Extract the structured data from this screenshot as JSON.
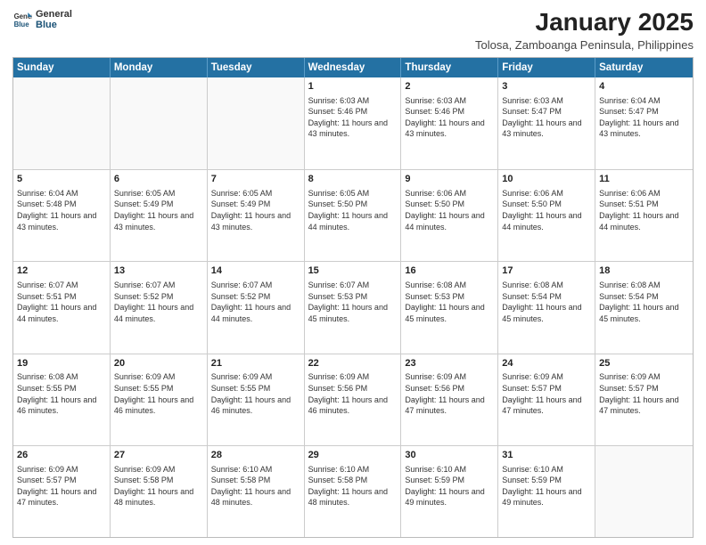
{
  "header": {
    "logo_general": "General",
    "logo_blue": "Blue",
    "month_title": "January 2025",
    "location": "Tolosa, Zamboanga Peninsula, Philippines"
  },
  "days_of_week": [
    "Sunday",
    "Monday",
    "Tuesday",
    "Wednesday",
    "Thursday",
    "Friday",
    "Saturday"
  ],
  "weeks": [
    [
      {
        "day": "",
        "sunrise": "",
        "sunset": "",
        "daylight": "",
        "empty": true
      },
      {
        "day": "",
        "sunrise": "",
        "sunset": "",
        "daylight": "",
        "empty": true
      },
      {
        "day": "",
        "sunrise": "",
        "sunset": "",
        "daylight": "",
        "empty": true
      },
      {
        "day": "1",
        "sunrise": "Sunrise: 6:03 AM",
        "sunset": "Sunset: 5:46 PM",
        "daylight": "Daylight: 11 hours and 43 minutes."
      },
      {
        "day": "2",
        "sunrise": "Sunrise: 6:03 AM",
        "sunset": "Sunset: 5:46 PM",
        "daylight": "Daylight: 11 hours and 43 minutes."
      },
      {
        "day": "3",
        "sunrise": "Sunrise: 6:03 AM",
        "sunset": "Sunset: 5:47 PM",
        "daylight": "Daylight: 11 hours and 43 minutes."
      },
      {
        "day": "4",
        "sunrise": "Sunrise: 6:04 AM",
        "sunset": "Sunset: 5:47 PM",
        "daylight": "Daylight: 11 hours and 43 minutes."
      }
    ],
    [
      {
        "day": "5",
        "sunrise": "Sunrise: 6:04 AM",
        "sunset": "Sunset: 5:48 PM",
        "daylight": "Daylight: 11 hours and 43 minutes."
      },
      {
        "day": "6",
        "sunrise": "Sunrise: 6:05 AM",
        "sunset": "Sunset: 5:49 PM",
        "daylight": "Daylight: 11 hours and 43 minutes."
      },
      {
        "day": "7",
        "sunrise": "Sunrise: 6:05 AM",
        "sunset": "Sunset: 5:49 PM",
        "daylight": "Daylight: 11 hours and 43 minutes."
      },
      {
        "day": "8",
        "sunrise": "Sunrise: 6:05 AM",
        "sunset": "Sunset: 5:50 PM",
        "daylight": "Daylight: 11 hours and 44 minutes."
      },
      {
        "day": "9",
        "sunrise": "Sunrise: 6:06 AM",
        "sunset": "Sunset: 5:50 PM",
        "daylight": "Daylight: 11 hours and 44 minutes."
      },
      {
        "day": "10",
        "sunrise": "Sunrise: 6:06 AM",
        "sunset": "Sunset: 5:50 PM",
        "daylight": "Daylight: 11 hours and 44 minutes."
      },
      {
        "day": "11",
        "sunrise": "Sunrise: 6:06 AM",
        "sunset": "Sunset: 5:51 PM",
        "daylight": "Daylight: 11 hours and 44 minutes."
      }
    ],
    [
      {
        "day": "12",
        "sunrise": "Sunrise: 6:07 AM",
        "sunset": "Sunset: 5:51 PM",
        "daylight": "Daylight: 11 hours and 44 minutes."
      },
      {
        "day": "13",
        "sunrise": "Sunrise: 6:07 AM",
        "sunset": "Sunset: 5:52 PM",
        "daylight": "Daylight: 11 hours and 44 minutes."
      },
      {
        "day": "14",
        "sunrise": "Sunrise: 6:07 AM",
        "sunset": "Sunset: 5:52 PM",
        "daylight": "Daylight: 11 hours and 44 minutes."
      },
      {
        "day": "15",
        "sunrise": "Sunrise: 6:07 AM",
        "sunset": "Sunset: 5:53 PM",
        "daylight": "Daylight: 11 hours and 45 minutes."
      },
      {
        "day": "16",
        "sunrise": "Sunrise: 6:08 AM",
        "sunset": "Sunset: 5:53 PM",
        "daylight": "Daylight: 11 hours and 45 minutes."
      },
      {
        "day": "17",
        "sunrise": "Sunrise: 6:08 AM",
        "sunset": "Sunset: 5:54 PM",
        "daylight": "Daylight: 11 hours and 45 minutes."
      },
      {
        "day": "18",
        "sunrise": "Sunrise: 6:08 AM",
        "sunset": "Sunset: 5:54 PM",
        "daylight": "Daylight: 11 hours and 45 minutes."
      }
    ],
    [
      {
        "day": "19",
        "sunrise": "Sunrise: 6:08 AM",
        "sunset": "Sunset: 5:55 PM",
        "daylight": "Daylight: 11 hours and 46 minutes."
      },
      {
        "day": "20",
        "sunrise": "Sunrise: 6:09 AM",
        "sunset": "Sunset: 5:55 PM",
        "daylight": "Daylight: 11 hours and 46 minutes."
      },
      {
        "day": "21",
        "sunrise": "Sunrise: 6:09 AM",
        "sunset": "Sunset: 5:55 PM",
        "daylight": "Daylight: 11 hours and 46 minutes."
      },
      {
        "day": "22",
        "sunrise": "Sunrise: 6:09 AM",
        "sunset": "Sunset: 5:56 PM",
        "daylight": "Daylight: 11 hours and 46 minutes."
      },
      {
        "day": "23",
        "sunrise": "Sunrise: 6:09 AM",
        "sunset": "Sunset: 5:56 PM",
        "daylight": "Daylight: 11 hours and 47 minutes."
      },
      {
        "day": "24",
        "sunrise": "Sunrise: 6:09 AM",
        "sunset": "Sunset: 5:57 PM",
        "daylight": "Daylight: 11 hours and 47 minutes."
      },
      {
        "day": "25",
        "sunrise": "Sunrise: 6:09 AM",
        "sunset": "Sunset: 5:57 PM",
        "daylight": "Daylight: 11 hours and 47 minutes."
      }
    ],
    [
      {
        "day": "26",
        "sunrise": "Sunrise: 6:09 AM",
        "sunset": "Sunset: 5:57 PM",
        "daylight": "Daylight: 11 hours and 47 minutes."
      },
      {
        "day": "27",
        "sunrise": "Sunrise: 6:09 AM",
        "sunset": "Sunset: 5:58 PM",
        "daylight": "Daylight: 11 hours and 48 minutes."
      },
      {
        "day": "28",
        "sunrise": "Sunrise: 6:10 AM",
        "sunset": "Sunset: 5:58 PM",
        "daylight": "Daylight: 11 hours and 48 minutes."
      },
      {
        "day": "29",
        "sunrise": "Sunrise: 6:10 AM",
        "sunset": "Sunset: 5:58 PM",
        "daylight": "Daylight: 11 hours and 48 minutes."
      },
      {
        "day": "30",
        "sunrise": "Sunrise: 6:10 AM",
        "sunset": "Sunset: 5:59 PM",
        "daylight": "Daylight: 11 hours and 49 minutes."
      },
      {
        "day": "31",
        "sunrise": "Sunrise: 6:10 AM",
        "sunset": "Sunset: 5:59 PM",
        "daylight": "Daylight: 11 hours and 49 minutes."
      },
      {
        "day": "",
        "sunrise": "",
        "sunset": "",
        "daylight": "",
        "empty": true
      }
    ]
  ]
}
